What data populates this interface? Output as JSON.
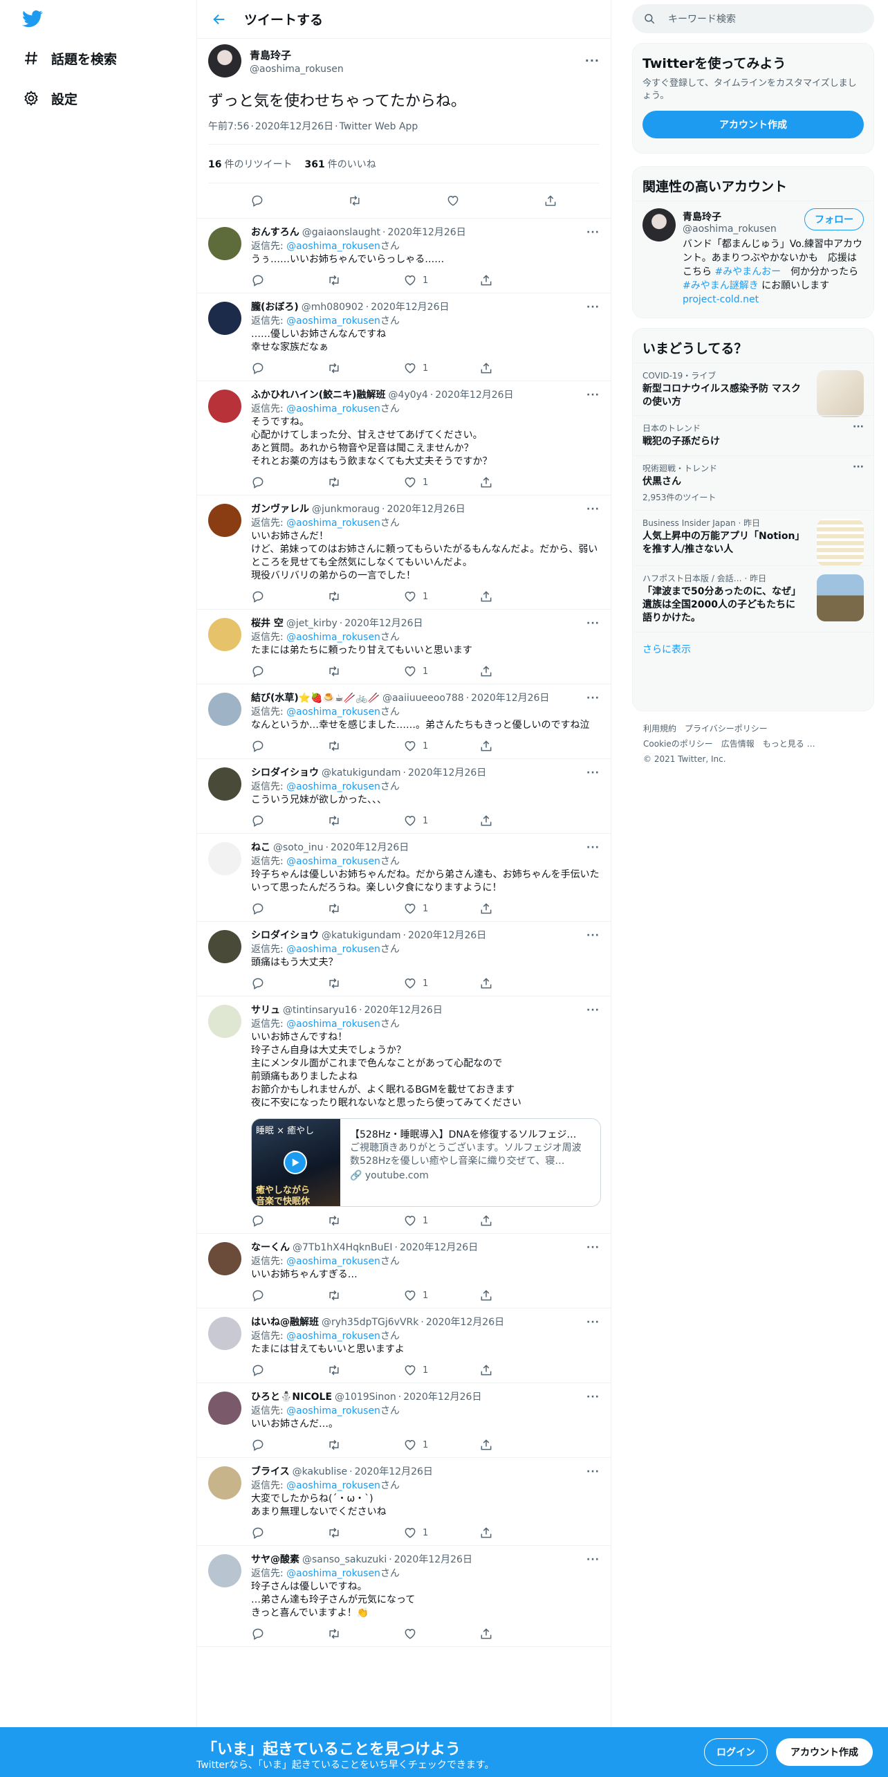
{
  "nav": {
    "explore_label": "話題を検索",
    "settings_label": "設定"
  },
  "header": {
    "title": "ツイートする"
  },
  "focal": {
    "name": "青島玲子",
    "handle": "@aoshima_rokusen",
    "text": "ずっと気を使わせちゃってたからね。",
    "time": "午前7:56",
    "date": "2020年12月26日",
    "source": "Twitter Web App",
    "retweets": "16",
    "retweets_label": "件のリツイート",
    "likes": "361",
    "likes_label": "件のいいね"
  },
  "reply_prefix": "返信先: ",
  "reply_handle": "@aoshima_rokusen",
  "reply_suffix": "さん",
  "replies": [
    {
      "name": "おんすろん",
      "handle": "@gaiaonslaught",
      "date": "2020年12月26日",
      "text": "うぅ……いいお姉ちゃんでいらっしゃる……",
      "likes": "1",
      "avatar_color": "#5e6b3a"
    },
    {
      "name": "朧(おぼろ)",
      "handle": "@mh080902",
      "date": "2020年12月26日",
      "text": "……優しいお姉さんなんですね\n幸せな家族だなぁ",
      "likes": "1",
      "avatar_color": "#1d2b4a"
    },
    {
      "name": "ふかひれハイン(鮫ニキ)融解班",
      "handle": "@4y0y4",
      "date": "2020年12月26日",
      "text": "そうですね。\n心配かけてしまった分、甘えさせてあげてください。\nあと質問。あれから物音や足音は聞こえませんか？\nそれとお薬の方はもう飲まなくても大丈夫そうですか？",
      "likes": "1",
      "avatar_color": "#b8323a"
    },
    {
      "name": "ガンヴァレル",
      "handle": "@junkmoraug",
      "date": "2020年12月26日",
      "text": "いいお姉さんだ！\nけど、弟妹ってのはお姉さんに頼ってもらいたがるもんなんだよ。だから、弱いところを見せても全然気にしなくてもいいんだよ。\n現役バリバリの弟からの一言でした！",
      "likes": "1",
      "avatar_color": "#8a3d12"
    },
    {
      "name": "桜井 空",
      "handle": "@jet_kirby",
      "date": "2020年12月26日",
      "text": "たまには弟たちに頼ったり甘えてもいいと思います",
      "likes": "1",
      "avatar_color": "#e6c36a"
    },
    {
      "name": "結び(水草)⭐🍓🍮☕🥢🚲🥢",
      "handle": "@aaiiuueeoo788",
      "date": "2020年12月26日",
      "text": "なんというか…幸せを感じました……。弟さんたちもきっと優しいのですね泣",
      "likes": "1",
      "avatar_color": "#9fb3c7"
    },
    {
      "name": "シロダイショウ",
      "handle": "@katukigundam",
      "date": "2020年12月26日",
      "text": "こういう兄妹が欲しかった、、、",
      "likes": "1",
      "avatar_color": "#4a4a38"
    },
    {
      "name": "ねこ",
      "handle": "@soto_inu",
      "date": "2020年12月26日",
      "text": "玲子ちゃんは優しいお姉ちゃんだね。だから弟さん達も、お姉ちゃんを手伝いたいって思ったんだろうね。楽しい夕食になりますように！",
      "likes": "1",
      "avatar_color": "#f2f2f2"
    },
    {
      "name": "シロダイショウ",
      "handle": "@katukigundam",
      "date": "2020年12月26日",
      "text": "頭痛はもう大丈夫？",
      "likes": "1",
      "avatar_color": "#4a4a38"
    },
    {
      "name": "サリュ",
      "handle": "@tintinsaryu16",
      "date": "2020年12月26日",
      "text": "いいお姉さんですね！\n玲子さん自身は大丈夫でしょうか？\n主にメンタル面がこれまで色んなことがあって心配なので\n前頭痛もありましたよね\nお節介かもしれませんが、よく眠れるBGMを載せておきます\n夜に不安になったり眠れないなと思ったら使ってみてください",
      "likes": "1",
      "avatar_color": "#dfe6d2",
      "card": {
        "title": "【528Hz・睡眠導入】DNAを修復するソルフェジ…",
        "desc": "ご視聴頂きありがとうございます。ソルフェジオ周波数528Hzを優しい癒やし音楽に織り交ぜて、寝…",
        "domain": "youtube.com",
        "img_text1": "睡眠 × 癒やし",
        "img_text2": "癒やしながら",
        "img_text3": "音楽で快眠休"
      }
    },
    {
      "name": "なーくん",
      "handle": "@7Tb1hX4HqknBuEI",
      "date": "2020年12月26日",
      "text": "いいお姉ちゃんすぎる…",
      "likes": "1",
      "avatar_color": "#6b4b3a"
    },
    {
      "name": "はいね@融解班",
      "handle": "@ryh35dpTGj6vVRk",
      "date": "2020年12月26日",
      "text": "たまには甘えてもいいと思いますよ",
      "likes": "1",
      "avatar_color": "#c9c9d4"
    },
    {
      "name": "ひろと⛄NICOLE",
      "handle": "@1019Sinon",
      "date": "2020年12月26日",
      "text": "いいお姉さんだ…。",
      "likes": "1",
      "avatar_color": "#7a5a6a"
    },
    {
      "name": "ブライス",
      "handle": "@kakublise",
      "date": "2020年12月26日",
      "text": "大変でしたからね(´・ω・`)\nあまり無理しないでくださいね",
      "likes": "1",
      "avatar_color": "#c8b48a"
    },
    {
      "name": "サヤ@酸素",
      "handle": "@sanso_sakuzuki",
      "date": "2020年12月26日",
      "text": "玲子さんは優しいですね。\n…弟さん達も玲子さんが元気になって\nきっと喜んでいますよ！👏",
      "likes": "",
      "avatar_color": "#b8c4d0"
    }
  ],
  "search": {
    "placeholder": "キーワード検索"
  },
  "signup_panel": {
    "title": "Twitterを使ってみよう",
    "subtitle": "今すぐ登録して、タイムラインをカスタマイズしましょう。",
    "button": "アカウント作成"
  },
  "related": {
    "title": "関連性の高いアカウント",
    "name": "青島玲子",
    "handle": "@aoshima_rokusen",
    "follow": "フォロー",
    "bio_1": "バンド「都まんじゅう」Vo.練習中アカウント。あまりつぶやかないかも　応援はこちら ",
    "bio_tag1": "#みやまんおー",
    "bio_2": "　何か分かったら ",
    "bio_tag2": "#みやまん謎解き",
    "bio_3": " にお願いします　",
    "bio_link": "project-cold.net"
  },
  "trends": {
    "title": "いまどうしてる？",
    "items": [
      {
        "category": "COVID-19・ライブ",
        "title": "新型コロナウイルス感染予防 マスクの使い方",
        "count": ""
      },
      {
        "category": "日本のトレンド",
        "title": "戦犯の子孫だらけ",
        "count": ""
      },
      {
        "category": "呪術廻戦・トレンド",
        "title": "伏黒さん",
        "count": "2,953件のツイート"
      }
    ],
    "news": [
      {
        "source": "Business Insider Japan",
        "time": "昨日",
        "title": "人気上昇中の万能アプリ「Notion」を推す人/推さない人"
      },
      {
        "source": "ハフポスト日本版 / 会話…",
        "time": "昨日",
        "title": "「津波まで50分あったのに、なぜ」遺族は全国2000人の子どもたちに語りかけた。"
      }
    ],
    "show_more": "さらに表示"
  },
  "footer": {
    "terms": "利用規約",
    "privacy": "プライバシーポリシー",
    "cookie": "Cookieのポリシー",
    "ads": "広告情報",
    "more": "もっと見る …",
    "copyright": "© 2021 Twitter, Inc."
  },
  "bottom_bar": {
    "headline": "「いま」起きていることを見つけよう",
    "sub": "Twitterなら、「いま」起きていることをいち早くチェックできます。",
    "login": "ログイン",
    "signup": "アカウント作成"
  },
  "colors": {
    "accent": "#1d9bf0",
    "text": "#0f1419",
    "muted": "#536471"
  }
}
